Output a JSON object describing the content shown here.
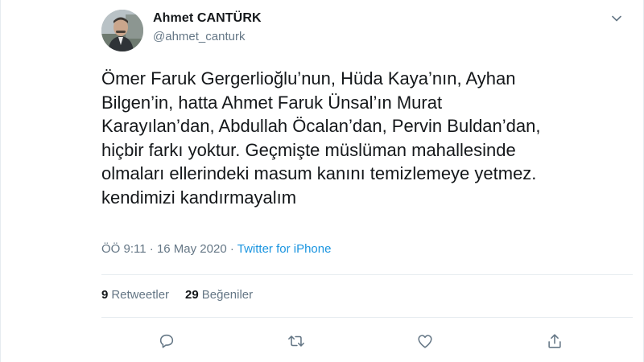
{
  "author": {
    "name": "Ahmet CANTÜRK",
    "handle": "@ahmet_canturk"
  },
  "tweet": {
    "text": "Ömer Faruk Gergerlioğlu’nun, Hüda Kaya’nın, Ayhan\nBilgen’in, hatta Ahmet Faruk Ünsal’ın Murat\nKarayılan’dan, Abdullah Öcalan’dan, Pervin Buldan’dan,\nhiçbir farkı yoktur. Geçmişte müslüman mahallesinde\nolmaları ellerindeki masum kanını temizlemeye yetmez.\nkendimizi kandırmayalım",
    "time": "ÖÖ 9:11",
    "separator": " · ",
    "date": "16 May 2020",
    "source": "Twitter for iPhone"
  },
  "stats": {
    "retweets_count": "9",
    "retweets_label": "Retweetler",
    "likes_count": "29",
    "likes_label": "Beğeniler"
  },
  "icons": {
    "caret": "chevron-down-icon",
    "reply": "reply-icon",
    "retweet": "retweet-icon",
    "like": "heart-icon",
    "share": "share-icon"
  },
  "colors": {
    "text": "#14171a",
    "secondary": "#657786",
    "link": "#1b95e0",
    "divider": "#e6ecf0"
  }
}
